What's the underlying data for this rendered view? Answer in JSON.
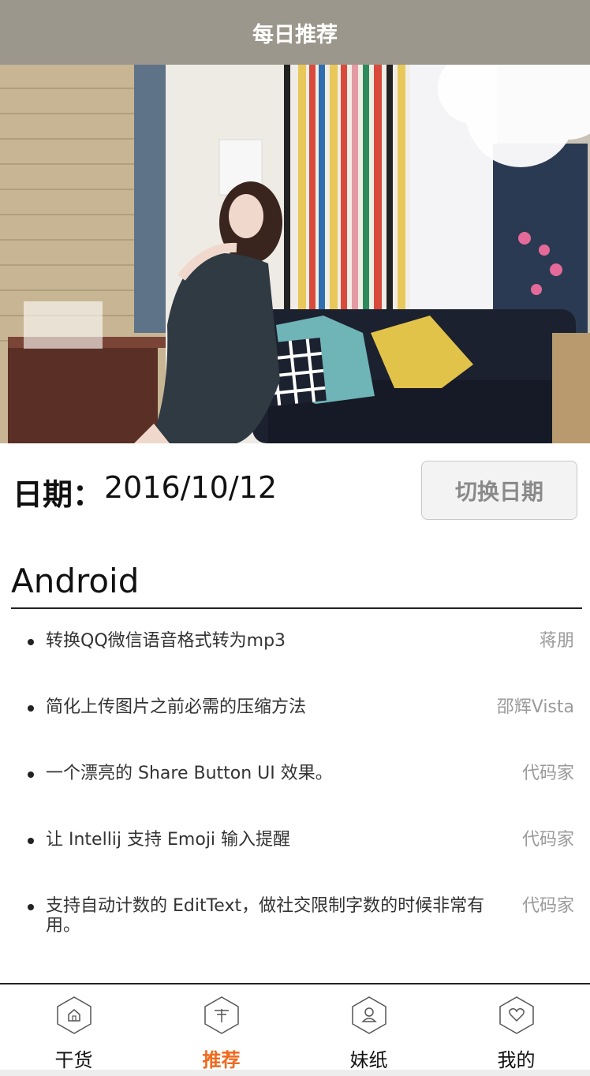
{
  "header": {
    "title": "每日推荐"
  },
  "hero": {
    "image_description_icon": "photo"
  },
  "date": {
    "label": "日期：",
    "value": "2016/10/12",
    "switch_label": "切换日期"
  },
  "section": {
    "title": "Android"
  },
  "articles": [
    {
      "title": "转换QQ微信语音格式转为mp3",
      "author": "蒋朋"
    },
    {
      "title": "简化上传图片之前必需的压缩方法",
      "author": "邵辉Vista"
    },
    {
      "title": "一个漂亮的 Share Button UI 效果。",
      "author": "代码家"
    },
    {
      "title": "让 Intellij 支持 Emoji 输入提醒",
      "author": "代码家"
    },
    {
      "title": "支持自动计数的 EditText，做社交限制字数的时候非常有用。",
      "author": "代码家"
    }
  ],
  "nav": {
    "items": [
      {
        "label": "干货",
        "icon": "home-icon"
      },
      {
        "label": "推荐",
        "icon": "signpost-icon"
      },
      {
        "label": "妹纸",
        "icon": "person-icon"
      },
      {
        "label": "我的",
        "icon": "heart-icon"
      }
    ],
    "active_index": 1,
    "active_color": "#f06a1e",
    "inactive_color": "#111111"
  },
  "colors": {
    "header_bg": "#9b978c"
  }
}
